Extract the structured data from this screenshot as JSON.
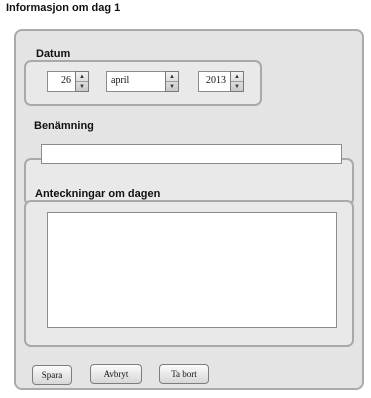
{
  "window": {
    "title": "Informasjon om dag 1"
  },
  "datum": {
    "label": "Datum",
    "day": "26",
    "month": "april",
    "year": "2013"
  },
  "benamning": {
    "label": "Benämning",
    "value": ""
  },
  "anteckningar": {
    "label": "Anteckningar om dagen",
    "value": ""
  },
  "buttons": {
    "save": "Spara",
    "cancel": "Avbryt",
    "delete": "Ta bort"
  },
  "icons": {
    "spinner_up": "up-arrow-icon",
    "spinner_down": "down-arrow-icon"
  }
}
